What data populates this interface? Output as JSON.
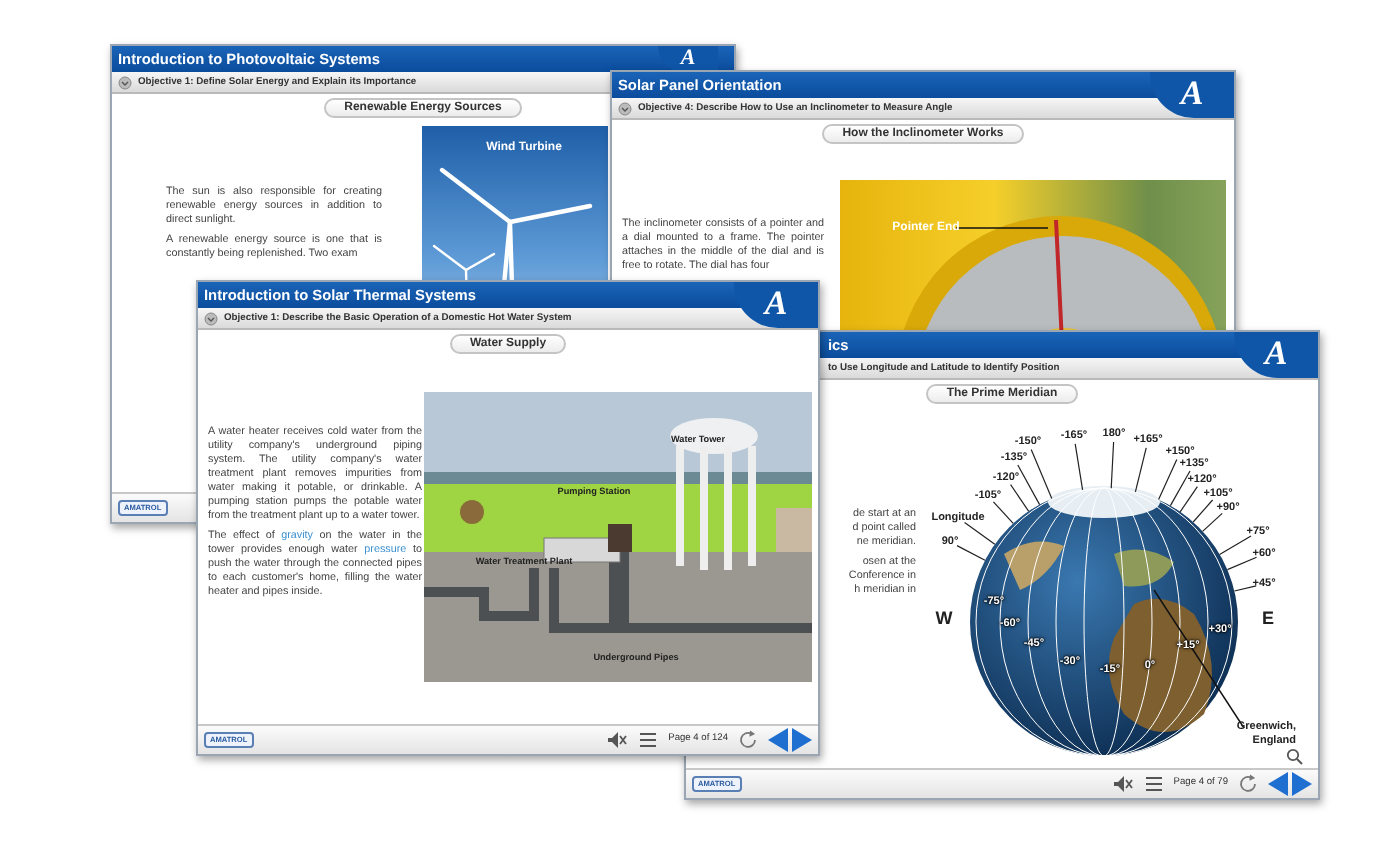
{
  "windows": [
    {
      "title": "Introduction to Photovoltaic Systems",
      "logo": "A",
      "objective": "Objective 1: Define Solar Energy and Explain its Importance",
      "heading": "Renewable Energy Sources",
      "paragraphs": [
        [
          {
            "kind": "plain",
            "text": "The sun is also responsible for creating renewable energy sources in addition to direct sunlight."
          }
        ],
        [
          {
            "kind": "plain",
            "text": "A renewable energy source is one that is constantly being replenished. Two exam"
          }
        ]
      ],
      "figure": {
        "kind": "turbine_photo",
        "labels": [
          "Wind Turbine"
        ]
      },
      "footer": {
        "brand": "AMATROL"
      }
    },
    {
      "title": "Solar Panel Orientation",
      "logo": "A",
      "objective": "Objective 4: Describe How to Use an Inclinometer to Measure Angle",
      "heading": "How the Inclinometer Works",
      "paragraphs": [
        [
          {
            "kind": "plain",
            "text": "The inclinometer consists of a pointer and a dial mounted to a frame. The pointer attaches in the middle of the dial and is free to rotate. The dial has four"
          }
        ]
      ],
      "figure": {
        "kind": "dial_photo",
        "labels": [
          "Pointer End"
        ]
      }
    },
    {
      "title": "ics",
      "logo": "A",
      "objective": "to Use Longitude and Latitude to Identify Position",
      "heading": "The Prime Meridian",
      "paragraphs": [
        [
          {
            "kind": "line",
            "text": "de start at an"
          },
          {
            "kind": "line",
            "text": "d point called"
          },
          {
            "kind": "line",
            "text": "ne meridian."
          }
        ],
        [
          {
            "kind": "line",
            "text": "osen at the"
          },
          {
            "kind": "line",
            "text": "Conference in"
          },
          {
            "kind": "line",
            "text": "h meridian in"
          }
        ]
      ],
      "figure": {
        "kind": "globe_diagram",
        "labels": [
          "-150°",
          "-165°",
          "180°",
          "+165°",
          "+150°",
          "+135°",
          "+120°",
          "+105°",
          "+90°",
          "+75°",
          "+60°",
          "+45°",
          "-135°",
          "-120°",
          "-105°",
          "Longitude",
          "90°",
          "W",
          "E",
          "-75°",
          "-60°",
          "-45°",
          "-30°",
          "-15°",
          "0°",
          "+15°",
          "+30°",
          "Greenwich, England"
        ]
      },
      "footer": {
        "brand": "AMATROL",
        "page": "Page 4 of 79"
      }
    },
    {
      "title": "Introduction to Solar Thermal Systems",
      "logo": "A",
      "objective": "Objective 1: Describe the Basic Operation of a Domestic Hot Water System",
      "heading": "Water Supply",
      "paragraphs": [
        [
          {
            "kind": "plain",
            "text": "A water heater receives cold water from the utility company's underground piping system. The utility company's water treatment plant removes impurities from water making it potable, or drinkable. A pumping station pumps the potable water from the treatment plant up to a water tower."
          }
        ],
        [
          {
            "kind": "plain",
            "text": "The effect of "
          },
          {
            "kind": "glossary",
            "text": "gravity"
          },
          {
            "kind": "plain",
            "text": " on the water in the tower provides enough water "
          },
          {
            "kind": "glossary",
            "text": "pressure"
          },
          {
            "kind": "plain",
            "text": " to push the water through the connected pipes to each customer's home, filling the water heater and pipes inside."
          }
        ]
      ],
      "figure": {
        "kind": "water_diagram",
        "labels": [
          "Water Tower",
          "Pumping Station",
          "Water Treatment Plant",
          "Underground Pipes"
        ]
      },
      "footer": {
        "brand": "AMATROL",
        "page": "Page 4 of 124"
      }
    }
  ]
}
